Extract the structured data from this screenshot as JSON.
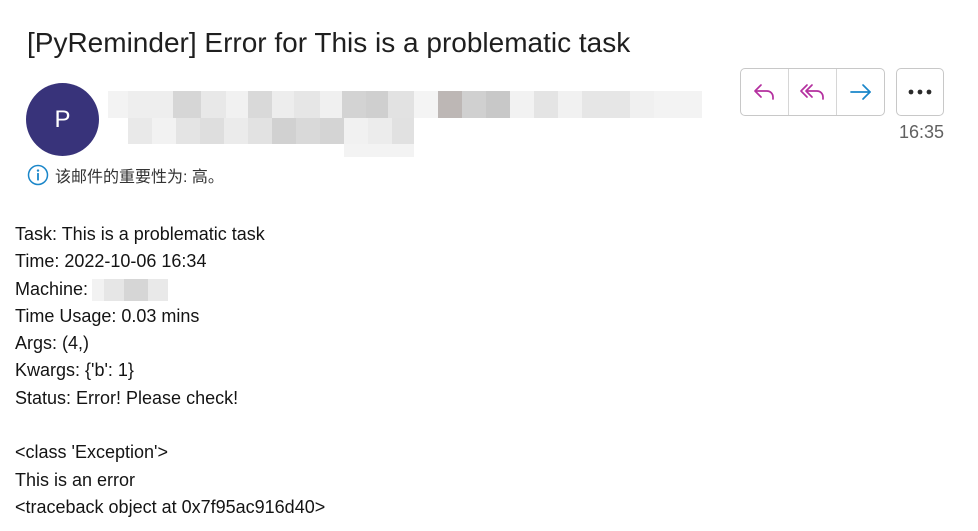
{
  "email": {
    "subject": "[PyReminder] Error for This is a problematic task",
    "avatar_letter": "P",
    "time": "16:35",
    "importance_notice": "该邮件的重要性为: 高。"
  },
  "actions": {
    "reply_icon": "reply-icon",
    "reply_all_icon": "reply-all-icon",
    "forward_icon": "forward-icon",
    "more_icon": "more-icon"
  },
  "body": {
    "task": "Task: This is a problematic task",
    "time": "Time: 2022-10-06 16:34",
    "machine_label": "Machine:",
    "time_usage": "Time Usage: 0.03 mins",
    "args": "Args: (4,)",
    "kwargs": "Kwargs: {'b': 1}",
    "status": "Status: Error! Please check!",
    "exception_class": "<class 'Exception'>",
    "exception_message": "This is an error",
    "traceback": "<traceback object at 0x7f95ac916d40>"
  },
  "colors": {
    "avatar_bg": "#38337a",
    "reply_accent": "#b4309f",
    "forward_accent": "#1a86c9",
    "info_icon": "#1a86c9"
  }
}
